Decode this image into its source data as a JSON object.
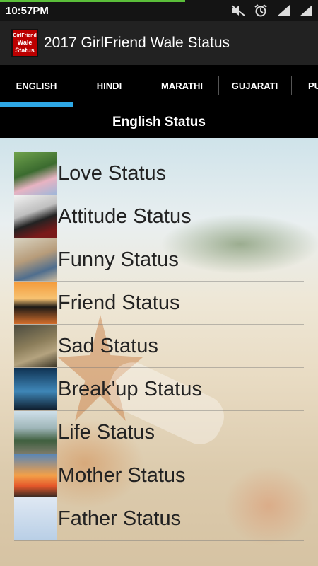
{
  "status_bar": {
    "time": "10:57PM",
    "icons": [
      "mute-icon",
      "alarm-icon",
      "signal-icon",
      "signal-icon"
    ]
  },
  "app_bar": {
    "title": "2017 GirlFriend Wale Status",
    "icon_text": [
      "GirlFriend",
      "Wale",
      "Status"
    ]
  },
  "tabs": [
    {
      "label": "ENGLISH",
      "active": true
    },
    {
      "label": "HINDI",
      "active": false
    },
    {
      "label": "MARATHI",
      "active": false
    },
    {
      "label": "GUJARATI",
      "active": false
    },
    {
      "label": "PU",
      "active": false
    }
  ],
  "section_header": "English Status",
  "list": [
    {
      "label": "Love Status"
    },
    {
      "label": "Attitude Status"
    },
    {
      "label": "Funny Status"
    },
    {
      "label": "Friend Status"
    },
    {
      "label": "Sad Status"
    },
    {
      "label": "Break'up Status"
    },
    {
      "label": "Life Status"
    },
    {
      "label": "Mother Status"
    },
    {
      "label": "Father Status"
    }
  ],
  "colors": {
    "accent": "#2ea8e6",
    "app_bar": "#222222",
    "status_progress": "#5bbf3a"
  }
}
